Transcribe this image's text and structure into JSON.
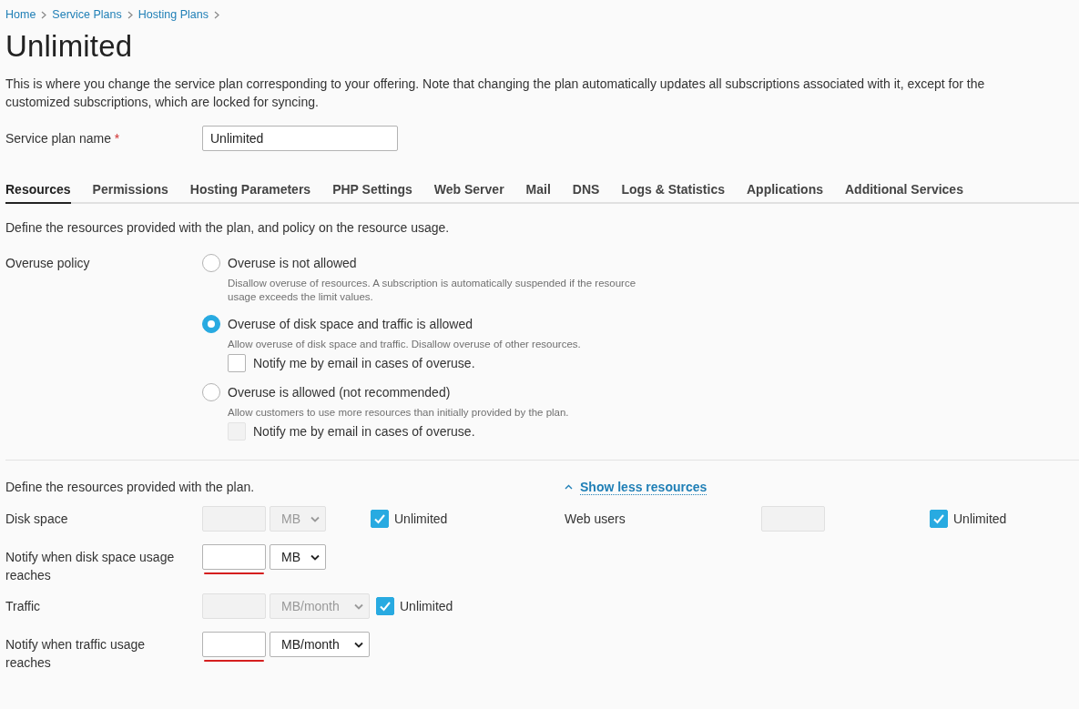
{
  "breadcrumbs": [
    {
      "label": "Home"
    },
    {
      "label": "Service Plans"
    },
    {
      "label": "Hosting Plans"
    }
  ],
  "title": "Unlimited",
  "intro": "This is where you change the service plan corresponding to your offering. Note that changing the plan automatically updates all subscriptions associated with it, except for the customized subscriptions, which are locked for syncing.",
  "plan_name": {
    "label": "Service plan name",
    "required_mark": "*",
    "value": "Unlimited"
  },
  "tabs": [
    {
      "label": "Resources",
      "selected": true
    },
    {
      "label": "Permissions",
      "selected": false
    },
    {
      "label": "Hosting Parameters",
      "selected": false
    },
    {
      "label": "PHP Settings",
      "selected": false
    },
    {
      "label": "Web Server",
      "selected": false
    },
    {
      "label": "Mail",
      "selected": false
    },
    {
      "label": "DNS",
      "selected": false
    },
    {
      "label": "Logs & Statistics",
      "selected": false
    },
    {
      "label": "Applications",
      "selected": false
    },
    {
      "label": "Additional Services",
      "selected": false
    }
  ],
  "resources_intro": "Define the resources provided with the plan, and policy on the resource usage.",
  "overuse_policy": {
    "label": "Overuse policy",
    "options": [
      {
        "label": "Overuse is not allowed",
        "selected": false,
        "description": "Disallow overuse of resources. A subscription is automatically suspended if the resource usage exceeds the limit values."
      },
      {
        "label": "Overuse of disk space and traffic is allowed",
        "selected": true,
        "description": "Allow overuse of disk space and traffic. Disallow overuse of other resources.",
        "notify": {
          "label": "Notify me by email in cases of overuse.",
          "checked": false,
          "disabled": false
        }
      },
      {
        "label": "Overuse is allowed (not recommended)",
        "selected": false,
        "description": "Allow customers to use more resources than initially provided by the plan.",
        "notify": {
          "label": "Notify me by email in cases of overuse.",
          "checked": false,
          "disabled": true
        }
      }
    ]
  },
  "limits": {
    "intro": "Define the resources provided with the plan.",
    "toggle": "Show less resources",
    "left_rows": [
      {
        "kind": "limit",
        "label": "Disk space",
        "unit": "MB",
        "disabled": true,
        "unlimited": {
          "label": "Unlimited",
          "checked": true
        }
      },
      {
        "kind": "notify",
        "label": "Notify when disk space usage reaches",
        "unit": "MB",
        "error": true
      },
      {
        "kind": "limit",
        "label": "Traffic",
        "unit": "MB/month",
        "disabled": true,
        "unlimited": {
          "label": "Unlimited",
          "checked": true
        }
      },
      {
        "kind": "notify",
        "label": "Notify when traffic usage reaches",
        "unit": "MB/month",
        "error": true
      }
    ],
    "right_rows": [
      {
        "kind": "limit",
        "label": "Web users",
        "disabled": true,
        "unlimited": {
          "label": "Unlimited",
          "checked": true
        }
      }
    ]
  }
}
